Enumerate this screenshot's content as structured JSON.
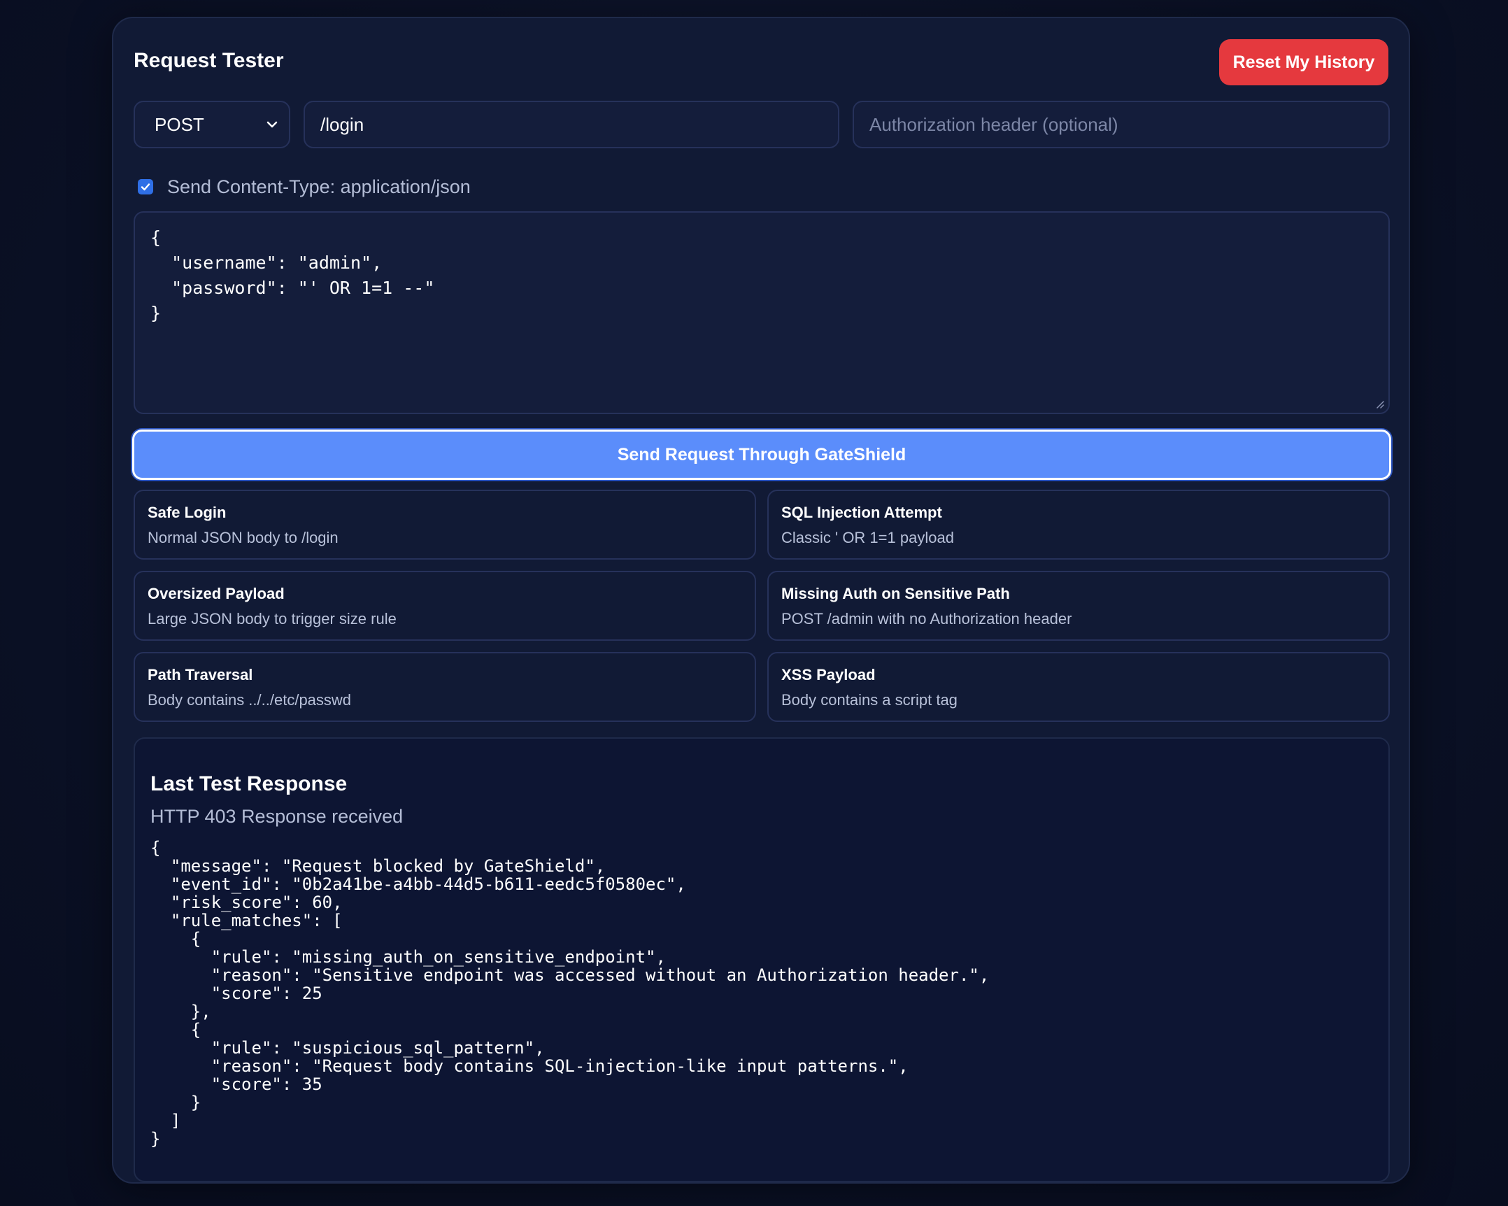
{
  "header": {
    "title": "Request Tester",
    "reset_label": "Reset My History"
  },
  "request": {
    "method": "POST",
    "path": "/login",
    "auth_placeholder": "Authorization header (optional)",
    "content_type_checked": true,
    "content_type_label": "Send Content-Type: application/json",
    "body": "{\n  \"username\": \"admin\",\n  \"password\": \"' OR 1=1 --\"\n}",
    "send_label": "Send Request Through GateShield"
  },
  "presets": [
    {
      "title": "Safe Login",
      "desc": "Normal JSON body to /login"
    },
    {
      "title": "SQL Injection Attempt",
      "desc": "Classic ' OR 1=1 payload"
    },
    {
      "title": "Oversized Payload",
      "desc": "Large JSON body to trigger size rule"
    },
    {
      "title": "Missing Auth on Sensitive Path",
      "desc": "POST /admin with no Authorization header"
    },
    {
      "title": "Path Traversal",
      "desc": "Body contains ../../etc/passwd"
    },
    {
      "title": "XSS Payload",
      "desc": "Body contains a script tag"
    }
  ],
  "response": {
    "title": "Last Test Response",
    "status": "HTTP 403 Response received",
    "body": "{\n  \"message\": \"Request blocked by GateShield\",\n  \"event_id\": \"0b2a41be-a4bb-44d5-b611-eedc5f0580ec\",\n  \"risk_score\": 60,\n  \"rule_matches\": [\n    {\n      \"rule\": \"missing_auth_on_sensitive_endpoint\",\n      \"reason\": \"Sensitive endpoint was accessed without an Authorization header.\",\n      \"score\": 25\n    },\n    {\n      \"rule\": \"suspicious_sql_pattern\",\n      \"reason\": \"Request body contains SQL-injection-like input patterns.\",\n      \"score\": 35\n    }\n  ]\n}"
  },
  "colors": {
    "background": "#0c1228",
    "card": "#111a35",
    "reset_button": "#e5393e",
    "send_button": "#5b8dfb",
    "checkbox": "#2f6fe6"
  },
  "icons": {
    "method_dropdown": "chevron-down-icon",
    "checkbox": "checkmark-icon",
    "resize": "resize-grip-icon"
  }
}
